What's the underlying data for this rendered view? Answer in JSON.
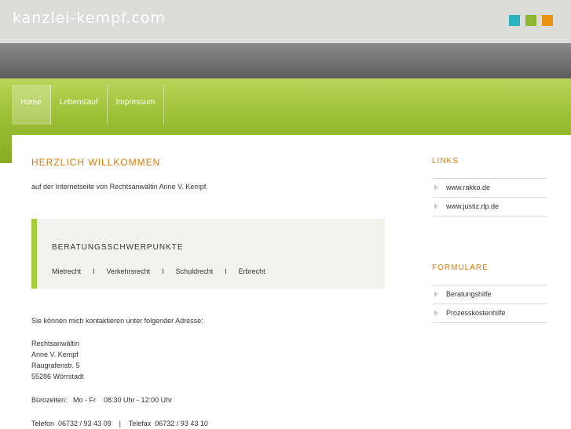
{
  "header": {
    "site_title": "kanzlei-kempf.com",
    "swatches": [
      "#2bb3c0",
      "#8fb531",
      "#e8920f"
    ]
  },
  "nav": {
    "items": [
      {
        "label": "Home",
        "active": true
      },
      {
        "label": "Lebenslauf",
        "active": false
      },
      {
        "label": "Impressum",
        "active": false
      }
    ]
  },
  "main": {
    "heading": "HERZLICH WILLKOMMEN",
    "intro": "auf der Internetseite von Rechtsanwältin Anne V. Kempf.",
    "focus_box": {
      "title": "BERATUNGSSCHWERPUNKTE",
      "items": [
        "Mietrecht",
        "Verkehrsrecht",
        "Schuldrecht",
        "Erbrecht"
      ],
      "separator": "I"
    },
    "contact_intro": "Sie können mich kontaktieren unter folgender Adresse:",
    "address": [
      "Rechtsanwältin",
      "Anne V. Kempf",
      "Raugrafenstr. 5",
      "55286 Wörrstadt"
    ],
    "office_hours": "Bürozeiten:   Mo - Fr    08:30 Uhr - 12:00 Uhr",
    "phone_fax": "Telefon  06732 / 93 43 09    |    Telefax  06732 / 93 43 10"
  },
  "sidebar": {
    "links_title": "LINKS",
    "links": [
      "www.rakko.de",
      "www.justiz.rlp.de"
    ],
    "forms_title": "FORMULARE",
    "forms": [
      "Beratungshilfe",
      "Prozesskostenhilfe"
    ]
  },
  "colors": {
    "accent_orange": "#e07a00",
    "accent_green": "#a6cc3a"
  }
}
